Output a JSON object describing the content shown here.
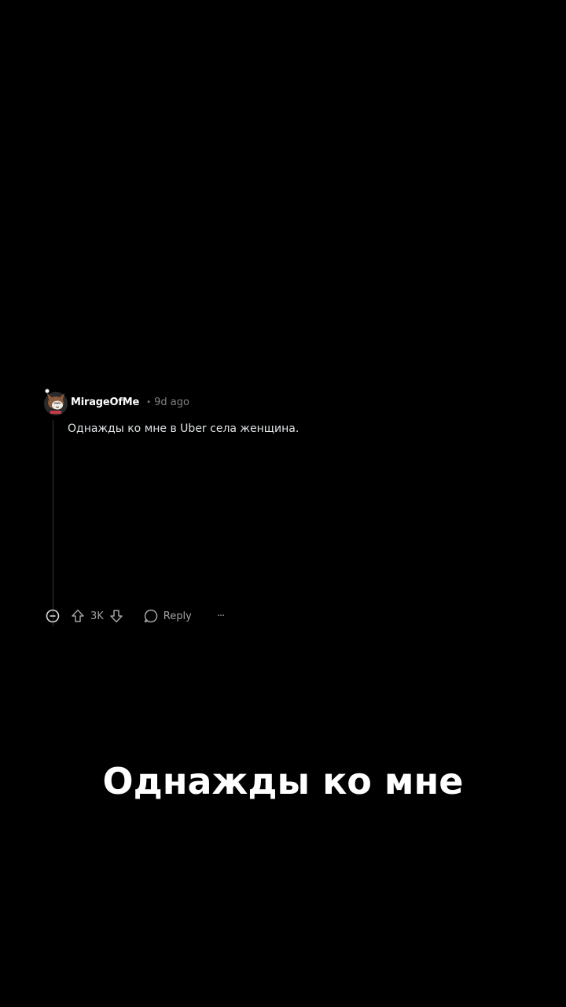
{
  "comment": {
    "username": "MirageOfMe",
    "separator": "•",
    "timestamp": "9d ago",
    "text": "Однажды ко мне в Uber села женщина.",
    "vote_count": "3K",
    "reply_label": "Reply",
    "more_label": "···"
  },
  "caption": {
    "text": "Однажды ко мне"
  },
  "colors": {
    "background": "#000000",
    "text_primary": "#ffffff",
    "text_muted": "#818384",
    "thread_line": "#343536",
    "avatar_brown": "#8a5a3c"
  },
  "icons": {
    "collapse": "minus-circle-icon",
    "upvote": "arrow-up-icon",
    "downvote": "arrow-down-icon",
    "reply": "speech-bubble-icon",
    "more": "more-dots-icon"
  }
}
